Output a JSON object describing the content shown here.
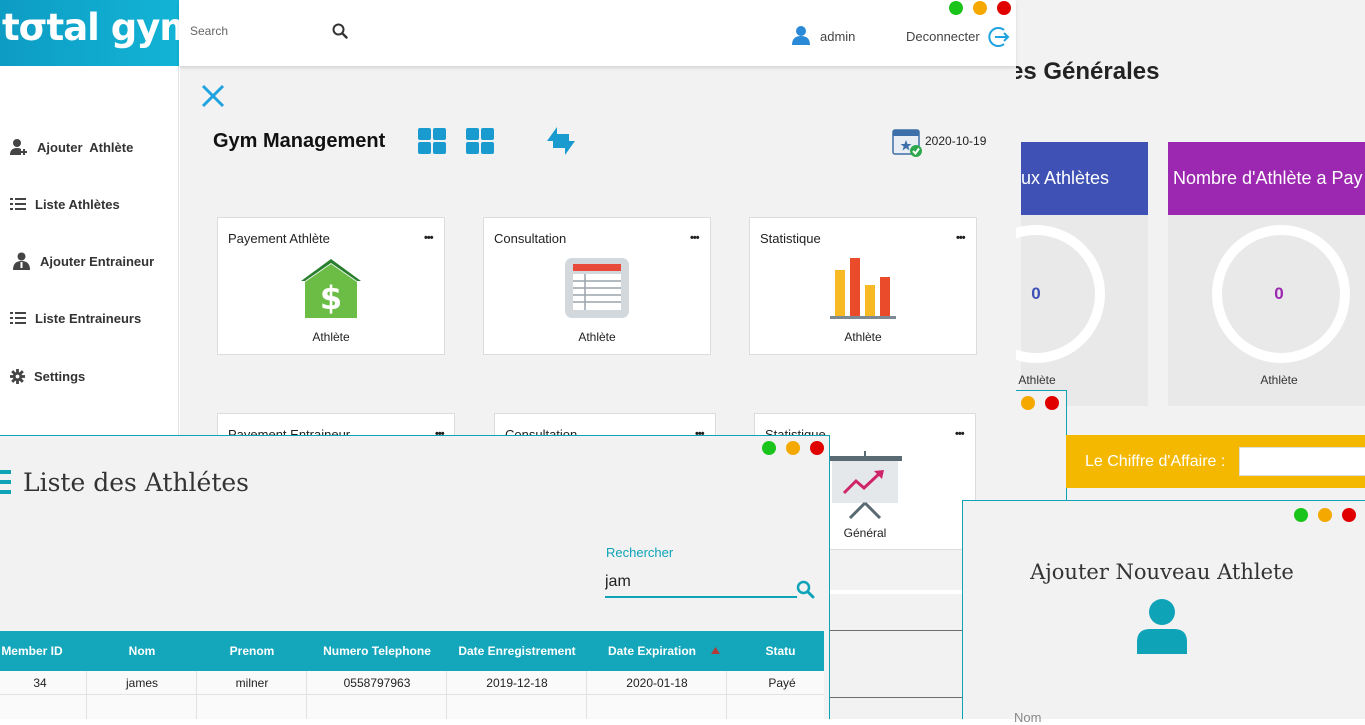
{
  "app": {
    "logo_text": "tσtal gym"
  },
  "stats": {
    "title": "es Générales",
    "cards": [
      {
        "header": "ux Athlètes",
        "value": "0",
        "footer": "Athlète",
        "color": "#3f51b5"
      },
      {
        "header": "Nombre  d'Athlète a Pay",
        "value": "0",
        "footer": "Athlète",
        "color": "#9c27b0"
      }
    ],
    "ca_label": "Le Chiffre d'Affaire :",
    "ca_value": ""
  },
  "topbar": {
    "search_placeholder": "Search",
    "user_name": "admin",
    "logout_label": "Deconnecter"
  },
  "sidebar": {
    "items": [
      {
        "label": "Ajouter  Athlète",
        "icon": "add-user-icon"
      },
      {
        "label": "Liste Athlètes",
        "icon": "list-icon"
      },
      {
        "label": "Ajouter Entraineur",
        "icon": "coach-icon"
      },
      {
        "label": "Liste Entraineurs",
        "icon": "list-icon"
      },
      {
        "label": "Settings",
        "icon": "gear-icon"
      }
    ]
  },
  "main": {
    "title": "Gym Management",
    "date": "2020-10-19",
    "tiles_row1": [
      {
        "title": "Payement Athlète",
        "sub": "Athlète",
        "icon": "money-house-icon"
      },
      {
        "title": "Consultation",
        "sub": "Athlète",
        "icon": "table-icon"
      },
      {
        "title": "Statistique",
        "sub": "Athlète",
        "icon": "bar-chart-icon"
      }
    ],
    "tiles_row2": [
      {
        "title": "Payement Entraineur"
      },
      {
        "title": "Consultation"
      },
      {
        "title": "Statistique",
        "sub": "Général",
        "icon": "presentation-icon"
      }
    ],
    "more_label": "•••"
  },
  "list": {
    "title": "Liste des Athlétes",
    "search_label": "Rechercher",
    "search_value": "jam",
    "columns": [
      "Member ID",
      "Nom",
      "Prenom",
      "Numero Telephone",
      "Date Enregistrement",
      "Date Expiration",
      "Statu"
    ],
    "rows": [
      [
        "34",
        "james",
        "milner",
        "0558797963",
        "2019-12-18",
        "2020-01-18",
        "Payé"
      ]
    ]
  },
  "add_athlete": {
    "title": "Ajouter Nouveau Athlete",
    "nom_label": "Nom"
  },
  "colors": {
    "accent": "#0fa3b8",
    "dot_green": "#1bc41b",
    "dot_orange": "#f5a800",
    "dot_red": "#e00000"
  }
}
